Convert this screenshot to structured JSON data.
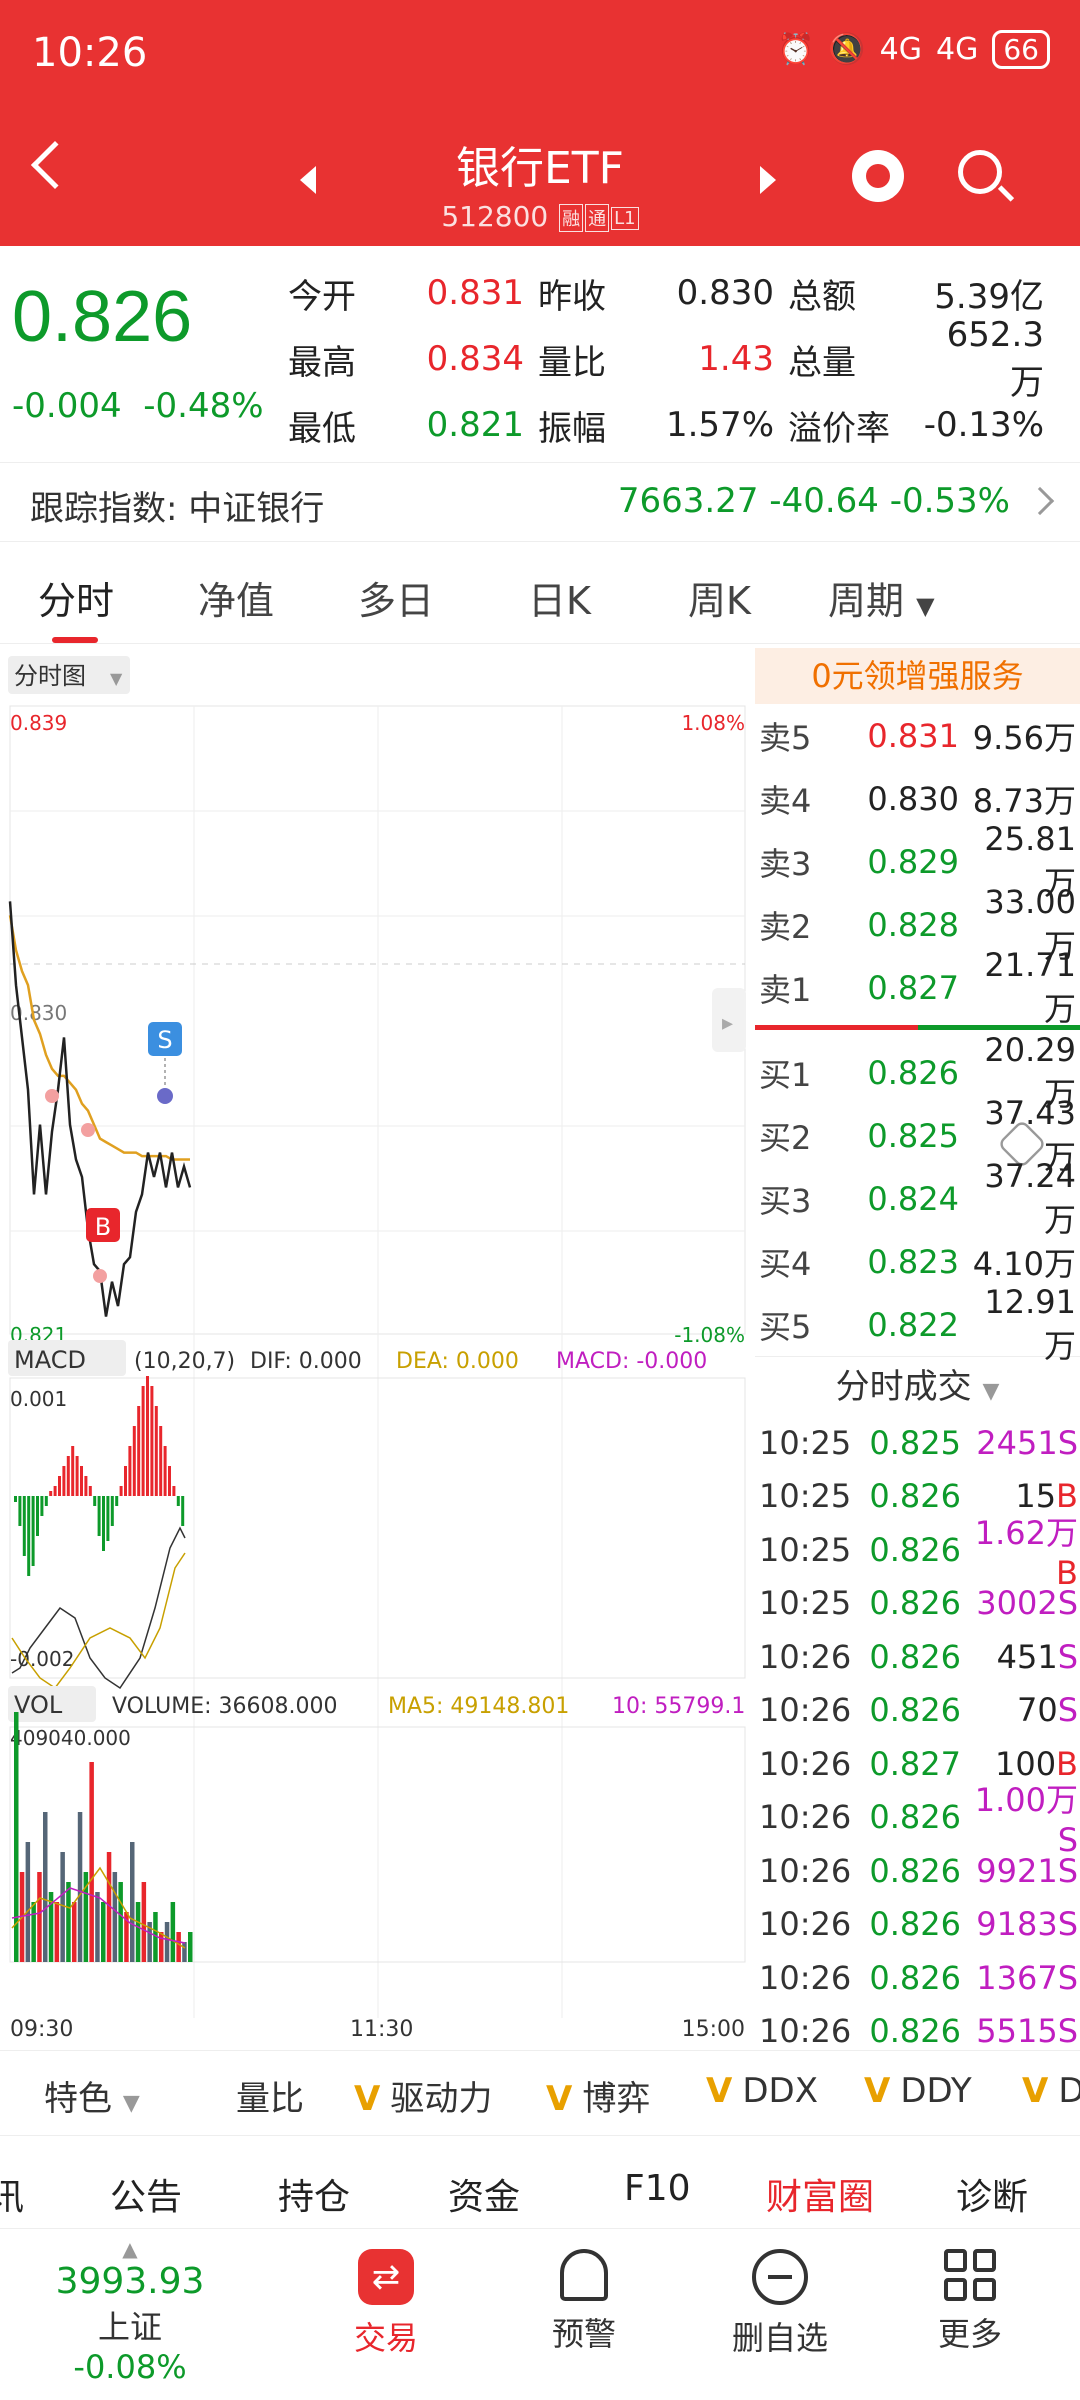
{
  "status": {
    "time": "10:26",
    "battery": "66",
    "net1": "4G",
    "net2": "4G"
  },
  "header": {
    "title": "银行ETF",
    "code": "512800",
    "tags": [
      "融",
      "通",
      "L1"
    ]
  },
  "quote": {
    "price": "0.826",
    "change": "-0.004",
    "change_pct": "-0.48%",
    "rows": [
      [
        {
          "k": "今开",
          "v": "0.831",
          "c": "red"
        },
        {
          "k": "昨收",
          "v": "0.830",
          "c": "black"
        },
        {
          "k": "总额",
          "v": "5.39亿",
          "c": "black"
        }
      ],
      [
        {
          "k": "最高",
          "v": "0.834",
          "c": "red"
        },
        {
          "k": "量比",
          "v": "1.43",
          "c": "red"
        },
        {
          "k": "总量",
          "v": "652.3万",
          "c": "black"
        }
      ],
      [
        {
          "k": "最低",
          "v": "0.821",
          "c": "green"
        },
        {
          "k": "振幅",
          "v": "1.57%",
          "c": "black"
        },
        {
          "k": "溢价率",
          "v": "-0.13%",
          "c": "black"
        }
      ]
    ]
  },
  "tracking": {
    "label": "跟踪指数: 中证银行",
    "value": "7663.27  -40.64  -0.53%"
  },
  "tabs": [
    "分时",
    "净值",
    "多日",
    "日K",
    "周K",
    "周期"
  ],
  "chart": {
    "selector": "分时图",
    "ymax": "0.839",
    "ymin": "0.821",
    "ymid": "0.830",
    "pmax": "1.08%",
    "pmin": "-1.08%",
    "macd_label": "MACD",
    "macd_params": "(10,20,7)",
    "dif": "DIF: 0.000",
    "dea": "DEA: 0.000",
    "macd": "MACD: -0.000",
    "macd_top": "0.001",
    "macd_bot": "-0.002",
    "vol_label": "VOL",
    "volume": "VOLUME: 36608.000",
    "ma5": "MA5: 49148.801",
    "ma10": "10: 55799.1",
    "vol_top": "409040.000",
    "xt": [
      "09:30",
      "11:30",
      "15:00"
    ],
    "buy": "B",
    "sell": "S"
  },
  "chart_data": {
    "type": "line",
    "price": [
      0.8334,
      0.831,
      0.8295,
      0.828,
      0.825,
      0.827,
      0.825,
      0.8268,
      0.828,
      0.8295,
      0.827,
      0.826,
      0.8255,
      0.824,
      0.823,
      0.8228,
      0.8215,
      0.8225,
      0.8218,
      0.823,
      0.8232,
      0.8245,
      0.825,
      0.8262,
      0.8255,
      0.8262,
      0.8252,
      0.8262,
      0.8252,
      0.8258,
      0.8252
    ],
    "avg": [
      0.833,
      0.832,
      0.8314,
      0.831,
      0.83,
      0.8296,
      0.829,
      0.8286,
      0.8284,
      0.8284,
      0.8282,
      0.828,
      0.8276,
      0.8274,
      0.827,
      0.8266,
      0.8265,
      0.8264,
      0.8263,
      0.8262,
      0.8262,
      0.8262,
      0.8261,
      0.8261,
      0.8261,
      0.8261,
      0.8261,
      0.826,
      0.826,
      0.826,
      0.826
    ]
  },
  "orderbook": {
    "banner": "0元领增强服务",
    "asks": [
      {
        "k": "卖5",
        "p": "0.831",
        "v": "9.56万",
        "c": "red"
      },
      {
        "k": "卖4",
        "p": "0.830",
        "v": "8.73万",
        "c": "black"
      },
      {
        "k": "卖3",
        "p": "0.829",
        "v": "25.81万",
        "c": "green"
      },
      {
        "k": "卖2",
        "p": "0.828",
        "v": "33.00万",
        "c": "green"
      },
      {
        "k": "卖1",
        "p": "0.827",
        "v": "21.71万",
        "c": "green"
      }
    ],
    "bids": [
      {
        "k": "买1",
        "p": "0.826",
        "v": "20.29万",
        "c": "green"
      },
      {
        "k": "买2",
        "p": "0.825",
        "v": "37.43万",
        "c": "green"
      },
      {
        "k": "买3",
        "p": "0.824",
        "v": "37.24万",
        "c": "green"
      },
      {
        "k": "买4",
        "p": "0.823",
        "v": "4.10万",
        "c": "green"
      },
      {
        "k": "买5",
        "p": "0.822",
        "v": "12.91万",
        "c": "green"
      }
    ],
    "trades_title": "分时成交",
    "trades": [
      {
        "t": "10:25",
        "p": "0.825",
        "v": "2451",
        "s": "S",
        "vc": "mag"
      },
      {
        "t": "10:25",
        "p": "0.826",
        "v": "15",
        "s": "B",
        "vc": "black"
      },
      {
        "t": "10:25",
        "p": "0.826",
        "v": "1.62万",
        "s": "B",
        "vc": "mag"
      },
      {
        "t": "10:25",
        "p": "0.826",
        "v": "3002",
        "s": "S",
        "vc": "mag"
      },
      {
        "t": "10:26",
        "p": "0.826",
        "v": "451",
        "s": "S",
        "vc": "black"
      },
      {
        "t": "10:26",
        "p": "0.826",
        "v": "70",
        "s": "S",
        "vc": "black"
      },
      {
        "t": "10:26",
        "p": "0.827",
        "v": "100",
        "s": "B",
        "vc": "black"
      },
      {
        "t": "10:26",
        "p": "0.826",
        "v": "1.00万",
        "s": "S",
        "vc": "mag"
      },
      {
        "t": "10:26",
        "p": "0.826",
        "v": "9921",
        "s": "S",
        "vc": "mag"
      },
      {
        "t": "10:26",
        "p": "0.826",
        "v": "9183",
        "s": "S",
        "vc": "mag"
      },
      {
        "t": "10:26",
        "p": "0.826",
        "v": "1367",
        "s": "S",
        "vc": "mag"
      },
      {
        "t": "10:26",
        "p": "0.826",
        "v": "5515",
        "s": "S",
        "vc": "mag"
      }
    ]
  },
  "indicators": [
    "特色",
    "量比",
    "驱动力",
    "博弈",
    "DDX",
    "DDY",
    "D"
  ],
  "navtabs": [
    "讯",
    "公告",
    "持仓",
    "资金",
    "F10",
    "财富圈",
    "诊断"
  ],
  "bottom": {
    "index_value": "3993.93",
    "index_name": "上证",
    "index_chg": "-0.08%",
    "items": [
      "交易",
      "预警",
      "删自选",
      "更多"
    ]
  }
}
